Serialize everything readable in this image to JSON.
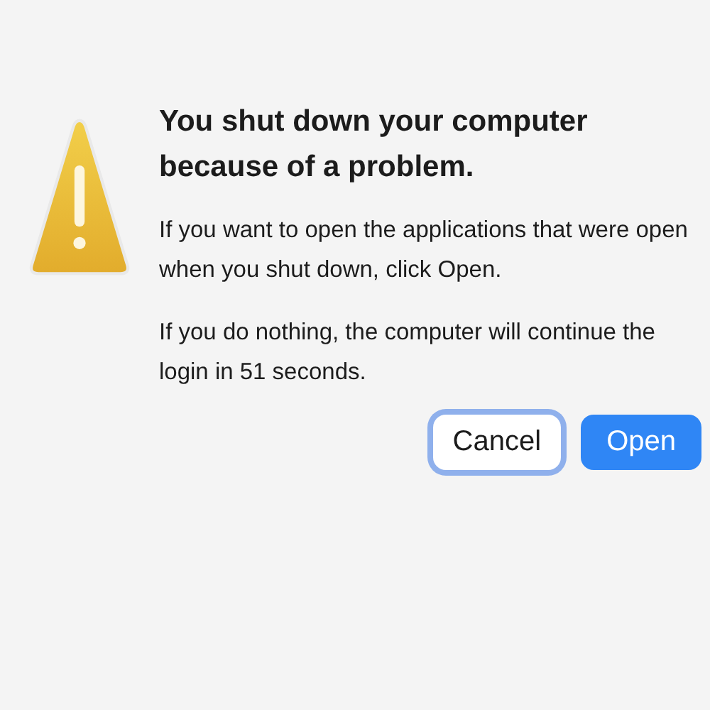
{
  "dialog": {
    "title": "You shut down your computer because of a problem.",
    "messages": [
      "If you want to open the applications that were open when you shut down, click Open.",
      "If you do nothing, the computer will continue the login in 51 seconds."
    ],
    "buttons": [
      {
        "label": "Cancel",
        "kind": "normal",
        "focused": true
      },
      {
        "label": "Open",
        "kind": "default",
        "focused": false
      }
    ]
  }
}
